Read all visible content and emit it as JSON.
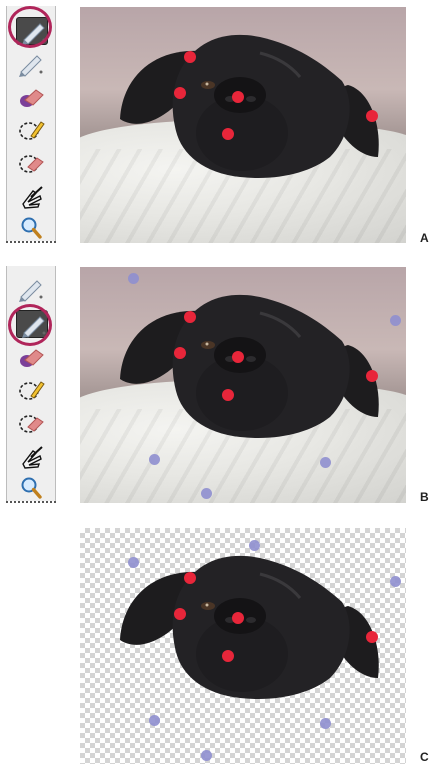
{
  "figures": [
    {
      "id": "A",
      "label": "A",
      "toolbar": true,
      "active_tool": "foreground-brush",
      "background": "photo",
      "foreground_marks": 5,
      "background_marks": 0
    },
    {
      "id": "B",
      "label": "B",
      "toolbar": true,
      "active_tool": "background-brush",
      "background": "photo",
      "foreground_marks": 5,
      "background_marks": 6
    },
    {
      "id": "C",
      "label": "C",
      "toolbar": false,
      "active_tool": null,
      "background": "transparent-checkerboard",
      "foreground_marks": 5,
      "background_marks": 6
    }
  ],
  "tools": [
    "foreground-brush-icon",
    "background-brush-icon",
    "eraser-icon",
    "smart-brush-icon",
    "detail-eraser-icon",
    "hand-pan-icon",
    "zoom-icon"
  ],
  "colors": {
    "foreground_mark": "#e8263a",
    "background_mark": "#8f8fcf",
    "highlight_ring": "#b0255a",
    "active_tool_bg": "#4a4a4a"
  }
}
